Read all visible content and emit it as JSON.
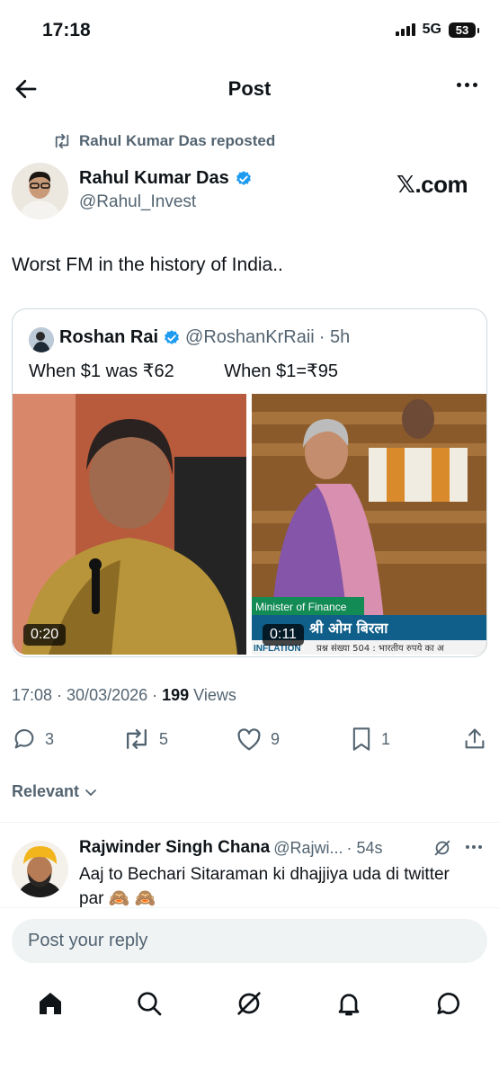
{
  "status_bar": {
    "time": "17:18",
    "network": "5G",
    "battery": "53"
  },
  "header": {
    "title": "Post"
  },
  "repost": {
    "text": "Rahul Kumar Das reposted"
  },
  "author": {
    "name": "Rahul Kumar Das",
    "handle": "@Rahul_Invest",
    "watermark": "𝕏.com"
  },
  "post": {
    "text": "Worst FM in the history of India.."
  },
  "quote": {
    "name": "Roshan Rai",
    "handle": "@RoshanKrRaii",
    "time": "· 5h",
    "text": "When $1 was ₹62          When $1=₹95",
    "videos": [
      {
        "duration": "0:20"
      },
      {
        "duration": "0:11",
        "caption_top": "Minister of Finance",
        "caption_main": "श्री ओम बिरला",
        "ticker_label": "INFLATION",
        "ticker_text": "प्रश्न संख्या 504 : भारतीय रुपये का अ"
      }
    ]
  },
  "meta": {
    "time_date": "17:08 · 30/03/2026 · ",
    "views_count": "199",
    "views_label": " Views"
  },
  "actions": {
    "replies": "3",
    "reposts": "5",
    "likes": "9",
    "bookmarks": "1"
  },
  "sort": {
    "label": "Relevant"
  },
  "reply": {
    "name": "Rajwinder Singh Chana",
    "handle": "@Rajwi...",
    "time": "· 54s",
    "text": "Aaj to Bechari Sitaraman ki dhajjiya uda di twitter par 🙈 🙈"
  },
  "composer": {
    "placeholder": "Post your reply"
  },
  "colors": {
    "accent": "#1d9bf0",
    "muted": "#536471",
    "text": "#0f1419"
  }
}
